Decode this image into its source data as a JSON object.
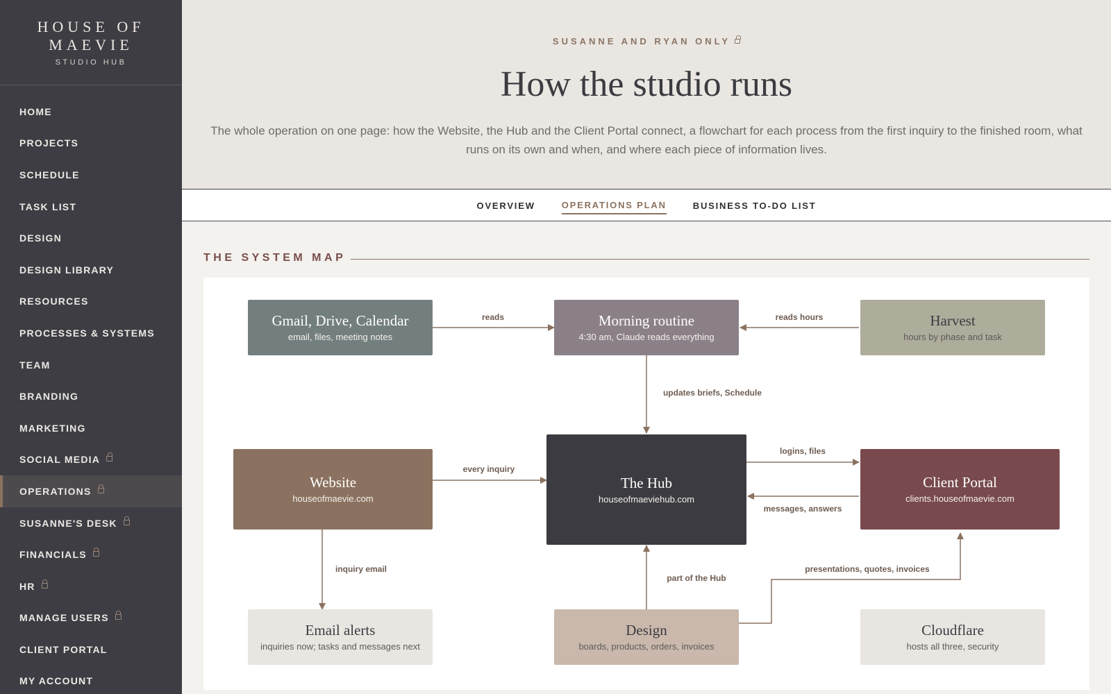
{
  "brand": {
    "line1": "HOUSE OF",
    "line2": "MAEVIE",
    "sub": "STUDIO HUB"
  },
  "sidebar": {
    "items": [
      {
        "label": "HOME",
        "locked": false
      },
      {
        "label": "PROJECTS",
        "locked": false
      },
      {
        "label": "SCHEDULE",
        "locked": false
      },
      {
        "label": "TASK LIST",
        "locked": false
      },
      {
        "label": "DESIGN",
        "locked": false
      },
      {
        "label": "DESIGN LIBRARY",
        "locked": false
      },
      {
        "label": "RESOURCES",
        "locked": false
      },
      {
        "label": "PROCESSES & SYSTEMS",
        "locked": false
      },
      {
        "label": "TEAM",
        "locked": false
      },
      {
        "label": "BRANDING",
        "locked": false
      },
      {
        "label": "MARKETING",
        "locked": false
      },
      {
        "label": "SOCIAL MEDIA",
        "locked": true
      },
      {
        "label": "OPERATIONS",
        "locked": true,
        "active": true
      },
      {
        "label": "SUSANNE'S DESK",
        "locked": true
      },
      {
        "label": "FINANCIALS",
        "locked": true
      },
      {
        "label": "HR",
        "locked": true
      },
      {
        "label": "MANAGE USERS",
        "locked": true
      },
      {
        "label": "CLIENT PORTAL",
        "locked": false
      },
      {
        "label": "MY ACCOUNT",
        "locked": false
      }
    ],
    "lock_icon": "lock-icon"
  },
  "header": {
    "eyebrow": "SUSANNE AND RYAN ONLY",
    "title": "How the studio runs",
    "description": "The whole operation on one page: how the Website, the Hub and the Client Portal connect, a flowchart for each process from the first inquiry to the finished room, what runs on its own and when, and where each piece of information lives."
  },
  "tabs": [
    {
      "label": "OVERVIEW",
      "active": false
    },
    {
      "label": "OPERATIONS PLAN",
      "active": true
    },
    {
      "label": "BUSINESS TO-DO LIST",
      "active": false
    }
  ],
  "section": {
    "title": "THE SYSTEM MAP"
  },
  "map": {
    "nodes": {
      "gmail": {
        "title": "Gmail, Drive, Calendar",
        "sub": "email, files, meeting notes"
      },
      "morning": {
        "title": "Morning routine",
        "sub": "4:30 am, Claude reads everything"
      },
      "harvest": {
        "title": "Harvest",
        "sub": "hours by phase and task"
      },
      "website": {
        "title": "Website",
        "sub": "houseofmaevie.com"
      },
      "hub": {
        "title": "The Hub",
        "sub": "houseofmaeviehub.com"
      },
      "portal": {
        "title": "Client Portal",
        "sub": "clients.houseofmaevie.com"
      },
      "email": {
        "title": "Email alerts",
        "sub": "inquiries now; tasks and messages next"
      },
      "design": {
        "title": "Design",
        "sub": "boards, products, orders, invoices"
      },
      "cloudflare": {
        "title": "Cloudflare",
        "sub": "hosts all three, security"
      }
    },
    "edges": {
      "reads": "reads",
      "reads_hours": "reads hours",
      "updates": "updates briefs, Schedule",
      "every_inquiry": "every inquiry",
      "logins": "logins, files",
      "messages": "messages, answers",
      "inquiry_email": "inquiry email",
      "part_of_hub": "part of the Hub",
      "presentations": "presentations, quotes, invoices"
    },
    "colors": {
      "gmail": "#737f7e",
      "morning": "#8b8088",
      "harvest": "#aeac9b",
      "website": "#8b7260",
      "hub": "#3c3b41",
      "portal": "#784a4d",
      "email": "#e9e6e1",
      "design": "#c9b8ab",
      "cloudflare": "#e9e6e1",
      "arrow": "#8b7260"
    }
  }
}
